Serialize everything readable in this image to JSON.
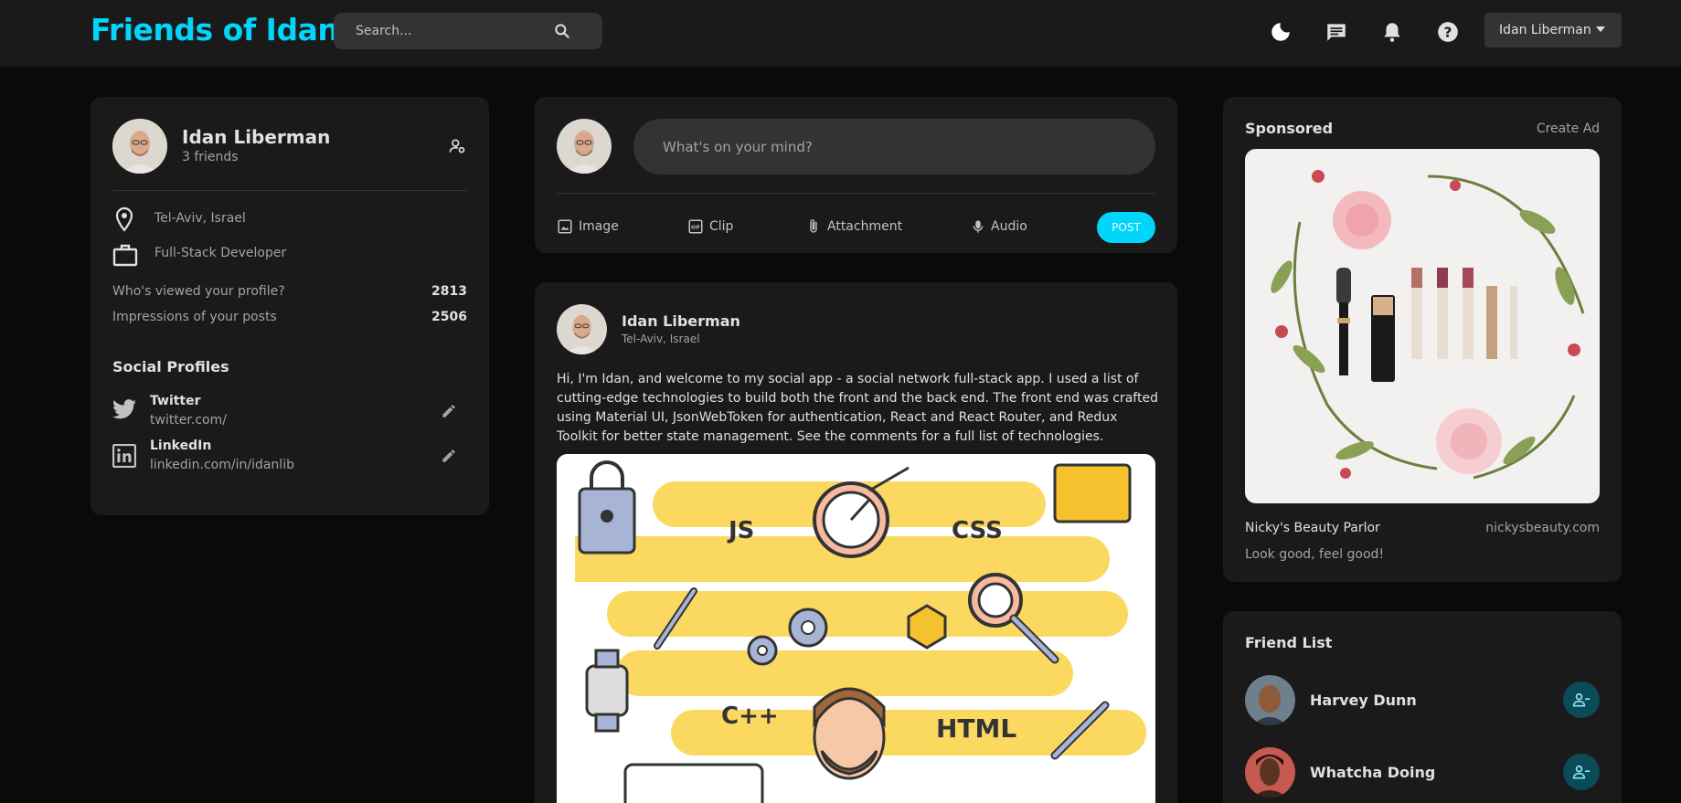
{
  "brand": "Friends of Idan",
  "search": {
    "placeholder": "Search..."
  },
  "navbar": {
    "user_name": "Idan Liberman"
  },
  "profile": {
    "name": "Idan Liberman",
    "friends": "3 friends",
    "location": "Tel-Aviv, Israel",
    "occupation": "Full-Stack Developer",
    "stats": [
      {
        "label": "Who's viewed your profile?",
        "value": "2813"
      },
      {
        "label": "Impressions of your posts",
        "value": "2506"
      }
    ],
    "social_title": "Social Profiles",
    "socials": [
      {
        "name": "Twitter",
        "url": "twitter.com/"
      },
      {
        "name": "LinkedIn",
        "url": "linkedin.com/in/idanlib"
      }
    ]
  },
  "composer": {
    "placeholder": "What's on your mind?",
    "actions": [
      "Image",
      "Clip",
      "Attachment",
      "Audio"
    ],
    "post_label": "POST"
  },
  "post": {
    "author": "Idan Liberman",
    "location": "Tel-Aviv, Israel",
    "text": "Hi, I'm Idan, and welcome to my social app - a social network full-stack app. I used a list of cutting-edge technologies to build both the front and the back end. The front end was crafted using Material UI, JsonWebToken for authentication, React and React Router, and Redux Toolkit for better state management. See the comments for a full list of technologies.",
    "image_labels": {
      "js": "JS",
      "css": "CSS",
      "cpp": "C++",
      "html": "HTML"
    }
  },
  "sponsored": {
    "title": "Sponsored",
    "create_ad": "Create Ad",
    "company": "Nicky's Beauty Parlor",
    "website": "nickysbeauty.com",
    "tagline": "Look good, feel good!"
  },
  "friend_list": {
    "title": "Friend List",
    "friends": [
      {
        "name": "Harvey Dunn"
      },
      {
        "name": "Whatcha Doing"
      }
    ]
  },
  "colors": {
    "accent": "#00d5fa",
    "panel": "#1a1a1a",
    "background": "#0a0a0a",
    "input": "#333333"
  }
}
